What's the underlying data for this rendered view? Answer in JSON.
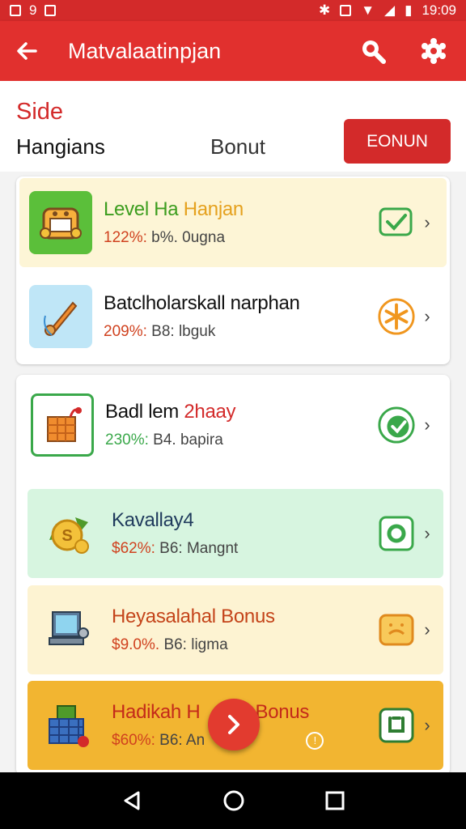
{
  "status_bar": {
    "time": "19:09",
    "left_glyph": "9"
  },
  "app_bar": {
    "title": "Matvalaatinpjan"
  },
  "subheader": {
    "section_title": "Side",
    "tab_left": "Hangians",
    "tab_right": "Bonut",
    "action_button": "EONUN"
  },
  "rows": [
    {
      "name_a": "Level Ha",
      "name_b": "Hanjan",
      "pct": "122%:",
      "detail": "b%. 0ugna"
    },
    {
      "name_a": "Batclholarskall narphan",
      "name_b": "",
      "pct": "209%:",
      "detail": "B8: lbguk"
    },
    {
      "name_a": "Badl lem",
      "name_b": "2haay",
      "pct": "230%:",
      "detail": "B4. bapira"
    },
    {
      "name_a": "Kavallay4",
      "name_b": "",
      "pct": "$62%:",
      "detail": "B6: Mangnt"
    },
    {
      "name_a": "Heyasalahal Bonus",
      "name_b": "",
      "pct": "$9.0%.",
      "detail": "B6: ligma"
    },
    {
      "name_a": "Hadikah H",
      "name_b": "h Bonus",
      "pct": "$60%:",
      "detail": "B6: An"
    }
  ],
  "colors": {
    "primary": "#e1302e",
    "row1_bg": "#fdf5d6",
    "row4_bg": "#d7f5e0",
    "row5_bg": "#fdf3d2",
    "row6_bg": "#f2b531"
  }
}
